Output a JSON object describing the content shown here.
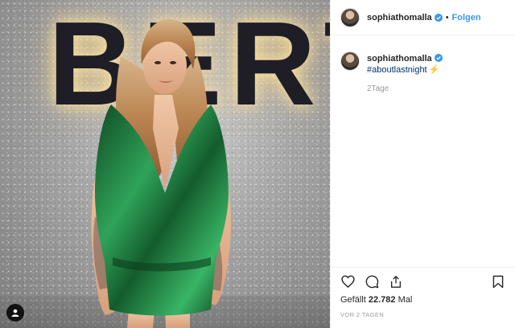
{
  "media": {
    "sign_text": "BERT"
  },
  "header": {
    "username": "sophiathomalla",
    "separator": "•",
    "follow_label": "Folgen"
  },
  "comment": {
    "username": "sophiathomalla",
    "hashtag": "#aboutlastnight",
    "emoji": "⚡",
    "time": "2Tage"
  },
  "actions": {
    "icons": [
      "heart-icon",
      "comment-icon",
      "share-icon",
      "bookmark-icon"
    ]
  },
  "likes": {
    "prefix": "Gefällt",
    "count": "22.782",
    "suffix": "Mal"
  },
  "post_time": "VOR 2 TAGEN",
  "colors": {
    "link": "#3897f0",
    "verified": "#3897f0",
    "hashtag": "#003569",
    "dress": "#1f7a3a",
    "muted": "#999999"
  }
}
